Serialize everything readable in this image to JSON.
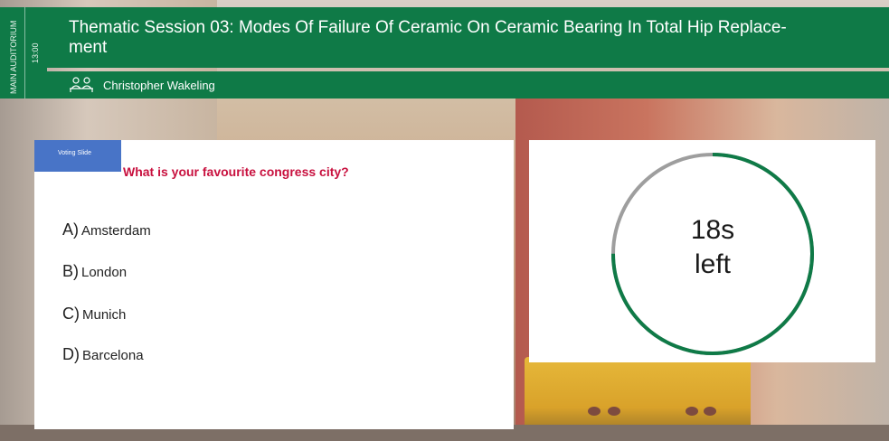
{
  "session": {
    "room": "MAIN AUDITORIUM",
    "time": "13:00",
    "title": "Thematic Session 03: Modes Of Failure Of Ceramic On Ceramic Bearing In Total Hip Replace-ment",
    "speaker": "Christopher Wakeling"
  },
  "voting": {
    "badge": "Voting Slide",
    "question": "What is your favourite congress city?",
    "options": [
      {
        "letter": "A)",
        "label": "Amsterdam"
      },
      {
        "letter": "B)",
        "label": "London"
      },
      {
        "letter": "C)",
        "label": "Munich"
      },
      {
        "letter": "D)",
        "label": "Barcelona"
      }
    ]
  },
  "timer": {
    "value": "18s",
    "unit": "left",
    "remaining_fraction": 0.75
  },
  "colors": {
    "header_green": "#0f7a47",
    "question_red": "#c8103e",
    "badge_blue": "#4874c7",
    "ring_remaining": "#0f7a47",
    "ring_elapsed": "#9e9e9e"
  },
  "icons": {
    "speaker": "people-icon"
  }
}
